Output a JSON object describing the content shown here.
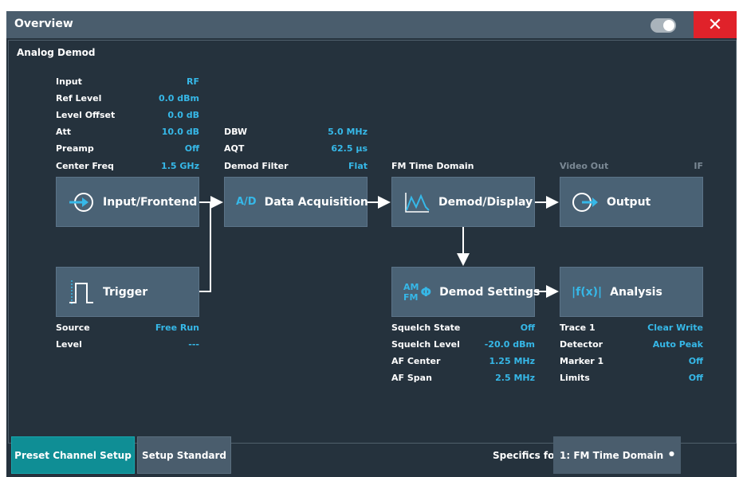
{
  "window": {
    "title": "Overview",
    "close_label": "✕"
  },
  "pane": {
    "title": "Analog Demod"
  },
  "input_params": [
    {
      "label": "Input",
      "value": "RF"
    },
    {
      "label": "Ref Level",
      "value": "0.0 dBm"
    },
    {
      "label": "Level Offset",
      "value": "0.0 dB"
    },
    {
      "label": "Att",
      "value": "10.0 dB"
    },
    {
      "label": "Preamp",
      "value": "Off"
    },
    {
      "label": "Center Freq",
      "value": "1.5 GHz"
    }
  ],
  "acq_params": [
    {
      "label": "DBW",
      "value": "5.0 MHz"
    },
    {
      "label": "AQT",
      "value": "62.5 µs"
    },
    {
      "label": "Demod Filter",
      "value": "Flat"
    }
  ],
  "demod_header": "FM Time Domain",
  "output_header": {
    "label": "Video Out",
    "value": "IF"
  },
  "blocks": {
    "input_frontend": "Input/Frontend",
    "data_acquisition": "Data Acquisition",
    "demod_display": "Demod/Display",
    "output": "Output",
    "trigger": "Trigger",
    "demod_settings": "Demod Settings",
    "analysis": "Analysis",
    "ad_glyph": "A/D",
    "am_glyph": "AM",
    "fm_glyph": "FM",
    "phi_glyph": "Φ",
    "fx_glyph": "|f(x)|"
  },
  "trigger_params": [
    {
      "label": "Source",
      "value": "Free Run"
    },
    {
      "label": "Level",
      "value": "---"
    }
  ],
  "demod_params": [
    {
      "label": "Squelch State",
      "value": "Off"
    },
    {
      "label": "Squelch Level",
      "value": "-20.0 dBm"
    },
    {
      "label": "AF Center",
      "value": "1.25 MHz"
    },
    {
      "label": "AF Span",
      "value": "2.5 MHz"
    }
  ],
  "analysis_params": [
    {
      "label": "Trace 1",
      "value": "Clear Write"
    },
    {
      "label": "Detector",
      "value": "Auto Peak"
    },
    {
      "label": "Marker 1",
      "value": "Off"
    },
    {
      "label": "Limits",
      "value": "Off"
    }
  ],
  "bottom": {
    "preset_label": "Preset Channel Setup",
    "setup_label": "Setup Standard",
    "specifics_label": "Specifics for",
    "specifics_value": "1: FM Time Domain"
  },
  "colors": {
    "accent": "#36b8e8",
    "block": "#4a6275",
    "background": "#25323d",
    "close": "#e0222a",
    "preset": "#0f8e95"
  }
}
